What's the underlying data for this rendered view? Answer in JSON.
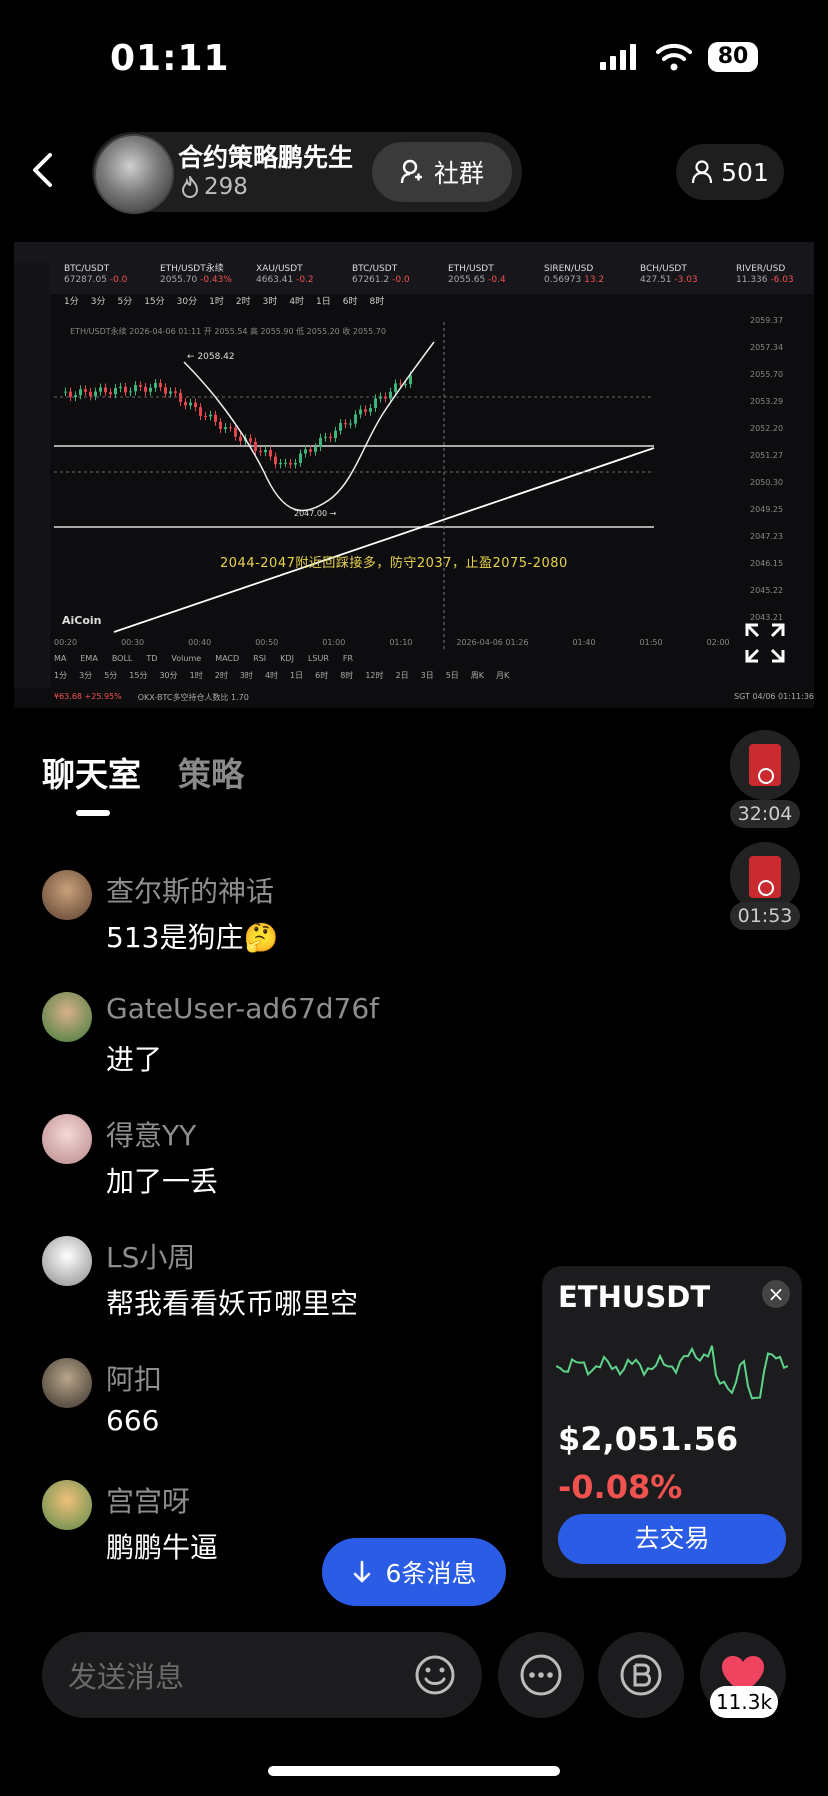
{
  "status_bar": {
    "time": "01:11",
    "battery": "80"
  },
  "header": {
    "host_name": "合约策略鹏先生",
    "host_fans": "298",
    "community_label": "社群",
    "viewer_count": "501"
  },
  "stream": {
    "tabs": [
      {
        "symbol": "BTC/USDT",
        "price": "67287.05",
        "change": "-0.0"
      },
      {
        "symbol": "ETH/USDT永续",
        "price": "2055.70",
        "change": "-0.43%"
      },
      {
        "symbol": "XAU/USDT",
        "price": "4663.41",
        "change": "-0.2"
      },
      {
        "symbol": "BTC/USDT",
        "price": "67261.2",
        "change": "-0.0"
      },
      {
        "symbol": "ETH/USDT",
        "price": "2055.65",
        "change": "-0.4"
      },
      {
        "symbol": "SIREN/USD",
        "price": "0.56973",
        "change": "13.2"
      },
      {
        "symbol": "BCH/USDT",
        "price": "427.51",
        "change": "-3.03"
      },
      {
        "symbol": "RIVER/USD",
        "price": "11.336",
        "change": "-6.03"
      }
    ],
    "toolbar": [
      "1分",
      "3分",
      "5分",
      "15分",
      "30分",
      "1时",
      "2时",
      "3时",
      "4时",
      "1日",
      "6时",
      "8时"
    ],
    "info_line": "ETH/USDT永续 2026-04-06 01:11 开 2055.54 高 2055.90 低 2055.20 收 2055.70",
    "high_label": "← 2058.42",
    "low_label": "2047.00 →",
    "annotation": "2044-2047附近回踩接多，防守2037，止盈2075-2080",
    "watermark": "AiCoin",
    "price_ticks": [
      "2059.37",
      "2057.34",
      "2055.70",
      "2053.29",
      "2052.20",
      "2051.27",
      "2050.30",
      "2049.25",
      "2047.23",
      "2046.15",
      "2045.22",
      "2043.21"
    ],
    "time_ticks": [
      "00:20",
      "00:30",
      "00:40",
      "00:50",
      "01:00",
      "01:10",
      "2026-04-06 01:26",
      "01:40",
      "01:50",
      "02:00"
    ],
    "indicators": [
      "MA",
      "EMA",
      "BOLL",
      "TD",
      "Volume",
      "MACD",
      "RSI",
      "KDJ",
      "LSUR",
      "FR"
    ],
    "ranges": [
      "1分",
      "3分",
      "5分",
      "15分",
      "30分",
      "1时",
      "2时",
      "3时",
      "4时",
      "1日",
      "6时",
      "8时",
      "12时",
      "2日",
      "3日",
      "5日",
      "周K",
      "月K"
    ],
    "footer_left": "¥63.68  +25.95%",
    "footer_mid": "OKX-BTC多空持仓人数比 1.70",
    "footer_right": "SGT 04/06 01:11:36"
  },
  "tabs": {
    "chat": "聊天室",
    "strategy": "策略"
  },
  "recordings": [
    {
      "duration": "32:04"
    },
    {
      "duration": "01:53"
    }
  ],
  "messages": [
    {
      "user": "查尔斯的神话",
      "text": "513是狗庄🤔"
    },
    {
      "user": "GateUser-ad67d76f",
      "text": "进了"
    },
    {
      "user": "得意YY",
      "text": "加了一丢"
    },
    {
      "user": "LS小周",
      "text": "帮我看看妖币哪里空"
    },
    {
      "user": "阿扣",
      "text": "666"
    },
    {
      "user": "宫宫呀",
      "text": "鹏鹏牛逼"
    }
  ],
  "ticker_card": {
    "symbol": "ETHUSDT",
    "price": "$2,051.56",
    "change": "-0.08%",
    "trade_label": "去交易"
  },
  "new_messages": "6条消息",
  "input": {
    "placeholder": "发送消息"
  },
  "likes": "11.3k",
  "colors": {
    "accent": "#2a5ce6",
    "negative": "#f0524f",
    "chart_line": "#5fd38a"
  }
}
